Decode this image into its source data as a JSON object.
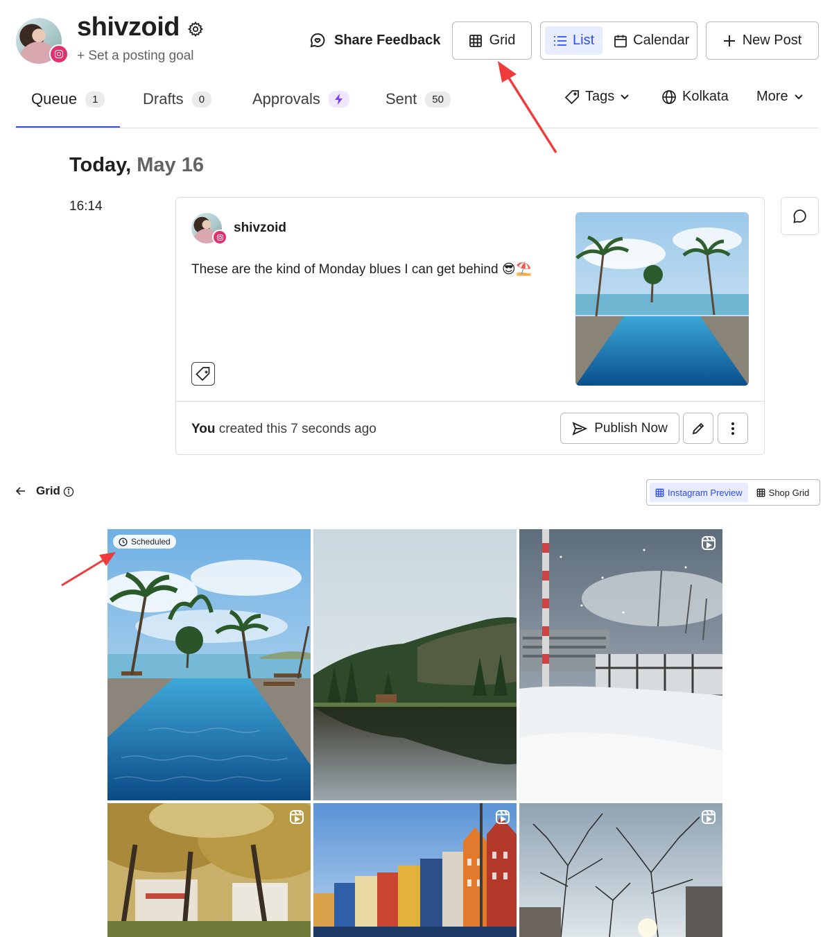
{
  "header": {
    "profile_name": "shivzoid",
    "posting_goal": "+ Set a posting goal",
    "share_feedback": "Share Feedback",
    "grid_label": "Grid",
    "list_label": "List",
    "calendar_label": "Calendar",
    "new_post_label": "New Post"
  },
  "tabs": [
    {
      "label": "Queue",
      "count": "1"
    },
    {
      "label": "Drafts",
      "count": "0"
    },
    {
      "label": "Approvals"
    },
    {
      "label": "Sent",
      "count": "50"
    }
  ],
  "filters": {
    "tags": "Tags",
    "timezone": "Kolkata",
    "more": "More"
  },
  "queue": {
    "day": "Today,",
    "date": "May 16",
    "time": "16:14",
    "post": {
      "handle": "shivzoid",
      "caption": "These are the kind of Monday blues I can get behind 😎⛱️",
      "created_by": "You",
      "created_rest": "created this 7 seconds ago",
      "publish_label": "Publish Now"
    }
  },
  "grid": {
    "title": "Grid",
    "instagram_preview": "Instagram Preview",
    "shop_grid": "Shop Grid",
    "scheduled_label": "Scheduled",
    "tiles": [
      {
        "scene": "pool-palms",
        "scheduled": true,
        "reel": false
      },
      {
        "scene": "forest-lake",
        "scheduled": false,
        "reel": false
      },
      {
        "scene": "snow-harbor",
        "scheduled": false,
        "reel": true
      },
      {
        "scene": "autumn-park",
        "scheduled": false,
        "reel": true
      },
      {
        "scene": "colorful-harbor",
        "scheduled": false,
        "reel": true
      },
      {
        "scene": "bare-trees",
        "scheduled": false,
        "reel": true
      }
    ]
  },
  "colors": {
    "accent": "#2c4bff",
    "instagram": "#e1306c",
    "annotation_arrow": "#ef3b3b"
  }
}
